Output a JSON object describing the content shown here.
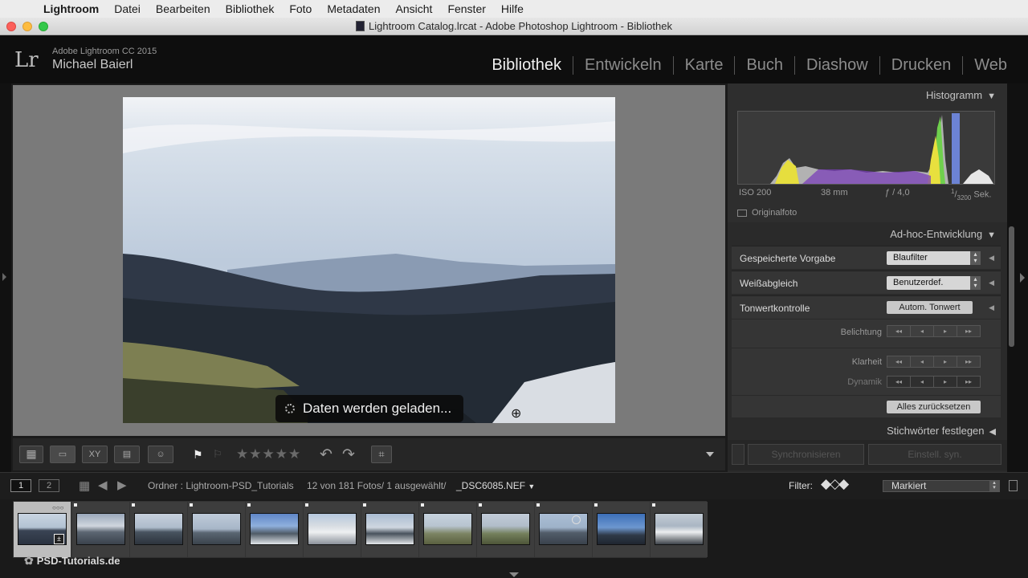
{
  "menubar": {
    "apple": "",
    "items": [
      "Lightroom",
      "Datei",
      "Bearbeiten",
      "Bibliothek",
      "Foto",
      "Metadaten",
      "Ansicht",
      "Fenster",
      "Hilfe"
    ]
  },
  "window": {
    "title": "Lightroom Catalog.lrcat - Adobe Photoshop Lightroom - Bibliothek"
  },
  "identity": {
    "logo": "Lr",
    "line1": "Adobe Lightroom CC 2015",
    "line2": "Michael Baierl"
  },
  "modules": [
    "Bibliothek",
    "Entwickeln",
    "Karte",
    "Buch",
    "Diashow",
    "Drucken",
    "Web"
  ],
  "viewer": {
    "loading_text": "Daten werden geladen...",
    "zoom_icon": "magnifier-plus-icon"
  },
  "histogram": {
    "title": "Histogramm",
    "iso": "ISO 200",
    "focal": "38 mm",
    "aperture": "ƒ / 4,0",
    "shutter_num": "1",
    "shutter_den": "3200",
    "shutter_unit": "Sek.",
    "original_label": "Originalfoto"
  },
  "quickdev": {
    "title": "Ad-hoc-Entwicklung",
    "preset_label": "Gespeicherte Vorgabe",
    "preset_value": "Blaufilter",
    "wb_label": "Weißabgleich",
    "wb_value": "Benutzerdef.",
    "tone_label": "Tonwertkontrolle",
    "auto_tone": "Autom. Tonwert",
    "exposure": "Belichtung",
    "clarity": "Klarheit",
    "vibrance": "Dynamik",
    "reset": "Alles zurücksetzen"
  },
  "keywords": {
    "title": "Stichwörter festlegen"
  },
  "sync": {
    "sync_label": "Synchronisieren",
    "sync_settings": "Einstell. syn."
  },
  "filmstrip_bar": {
    "page1": "1",
    "page2": "2",
    "folder_info": "Ordner : Lightroom-PSD_Tutorials",
    "count_info": "12 von 181 Fotos/ 1 ausgewählt/",
    "filename": "_DSC6085.NEF",
    "filter_label": "Filter:",
    "filter_value": "Markiert"
  },
  "watermark": "PSD-Tutorials.de",
  "colors": {
    "accent": "#f0f0f0",
    "panel": "#2a2a2a",
    "viewer_bg": "#7a7a7a"
  }
}
